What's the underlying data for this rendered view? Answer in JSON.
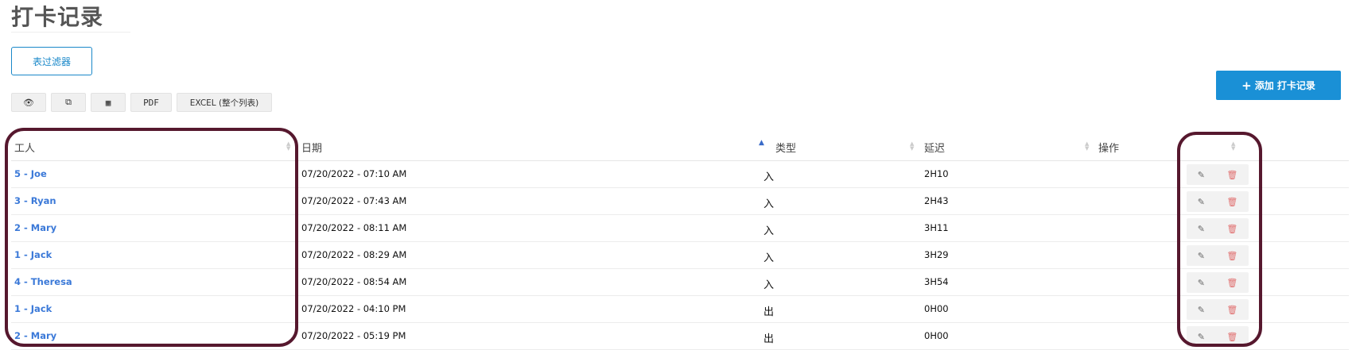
{
  "title": "打卡记录",
  "filter_button": "表过滤器",
  "export": {
    "view_icon": "eye-icon",
    "copy_icon": "copy-icon",
    "csv_icon": "table-icon",
    "pdf": "PDF",
    "excel": "EXCEL (整个列表)"
  },
  "add_button": {
    "icon": "plus-icon",
    "label": "添加 打卡记录"
  },
  "table": {
    "headers": {
      "worker": "工人",
      "date": "日期",
      "type": "类型",
      "delay": "延迟",
      "actions": "操作"
    },
    "rows": [
      {
        "worker": "5 - Joe",
        "date": "07/20/2022 - 07:10 AM",
        "type": "入",
        "delay": "2H10"
      },
      {
        "worker": "3 - Ryan",
        "date": "07/20/2022 - 07:43 AM",
        "type": "入",
        "delay": "2H43"
      },
      {
        "worker": "2 - Mary",
        "date": "07/20/2022 - 08:11 AM",
        "type": "入",
        "delay": "3H11"
      },
      {
        "worker": "1 - Jack",
        "date": "07/20/2022 - 08:29 AM",
        "type": "入",
        "delay": "3H29"
      },
      {
        "worker": "4 - Theresa",
        "date": "07/20/2022 - 08:54 AM",
        "type": "入",
        "delay": "3H54"
      },
      {
        "worker": "1 - Jack",
        "date": "07/20/2022 - 04:10 PM",
        "type": "出",
        "delay": "0H00"
      },
      {
        "worker": "2 - Mary",
        "date": "07/20/2022 - 05:19 PM",
        "type": "出",
        "delay": "0H00"
      }
    ]
  },
  "colors": {
    "accent": "#1a90d6",
    "link": "#3b79d8",
    "highlight": "#56182e",
    "delete": "#e07070"
  }
}
